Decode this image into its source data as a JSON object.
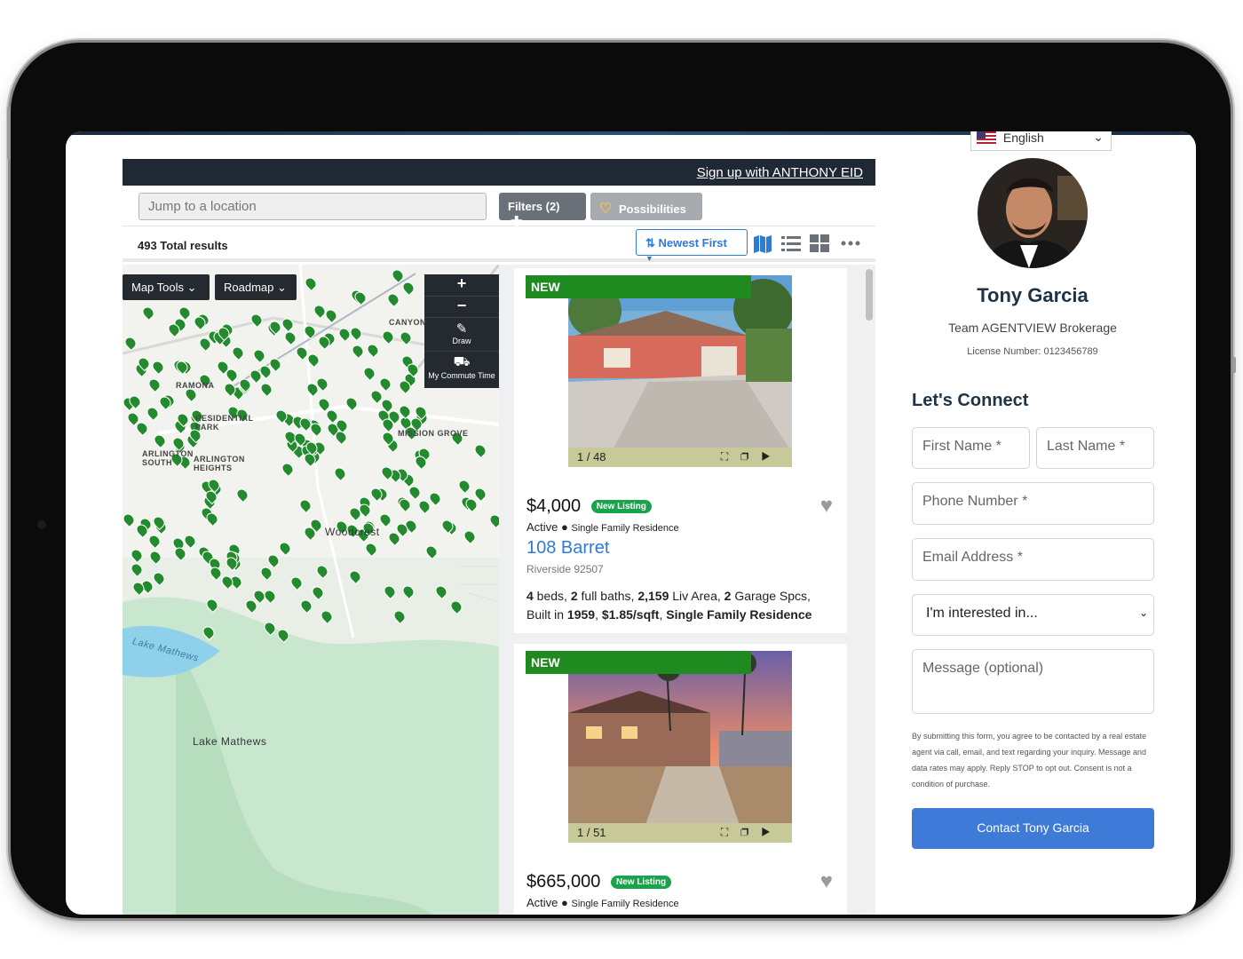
{
  "banner": {
    "signup_link": "Sign up with ANTHONY EID"
  },
  "search": {
    "placeholder": "Jump to a location"
  },
  "toolbar": {
    "filters_label": "Filters (2)",
    "possibilities_label": "Possibilities"
  },
  "results": {
    "total": "493 Total results",
    "sort_label": "Newest First"
  },
  "view_icons": [
    "map-view-icon",
    "list-view-icon",
    "grid-view-icon",
    "more-icon"
  ],
  "map": {
    "map_tools_label": "Map Tools",
    "roadmap_label": "Roadmap",
    "zoom_in": "+",
    "zoom_out": "−",
    "draw_label": "Draw",
    "commute_label": "My Commute Time",
    "labels": [
      "RAMONA",
      "CANYON",
      "RESIDENTIAL PARK",
      "MISSION GROVE",
      "ARLINGTON SOUTH",
      "ARLINGTON HEIGHTS",
      "Woodcrest",
      "Lake Mathews",
      "Lake Mathews"
    ]
  },
  "listings": [
    {
      "badge": "NEW",
      "photo_counter": "1 / 48",
      "price": "$4,000",
      "listing_badge": "New Listing",
      "status": "Active",
      "type": "Single Family Residence",
      "address": "108 Barret",
      "city": "Riverside 92507",
      "specs": {
        "beds": "4",
        "baths": "2",
        "liv_area": "2,159",
        "garage": "2",
        "built": "1959",
        "ppsf": "$1.85/sqft",
        "type": "Single Family Residence"
      }
    },
    {
      "badge": "NEW",
      "photo_counter": "1 / 51",
      "price": "$665,000",
      "listing_badge": "New Listing",
      "status": "Active",
      "type": "Single Family Residence"
    }
  ],
  "agent": {
    "language": "English",
    "name": "Tony Garcia",
    "team": "Team AGENTVIEW Brokerage",
    "license": "License Number: 0123456789"
  },
  "form": {
    "heading": "Let's Connect",
    "first_name": "First Name *",
    "last_name": "Last Name *",
    "phone": "Phone Number *",
    "email": "Email Address *",
    "interest": "I'm interested in...",
    "message": "Message (optional)",
    "disclaimer": "By submitting this form, you agree to be contacted by a real estate agent via call, email, and text regarding your inquiry. Message and data rates may apply. Reply STOP to opt out. Consent is not a condition of purchase.",
    "submit": "Contact Tony Garcia"
  },
  "colors": {
    "brand_green": "#1f8a1f",
    "accent_blue": "#3e7bd8",
    "link_blue": "#2d7bd6",
    "banner": "#1f2933"
  }
}
